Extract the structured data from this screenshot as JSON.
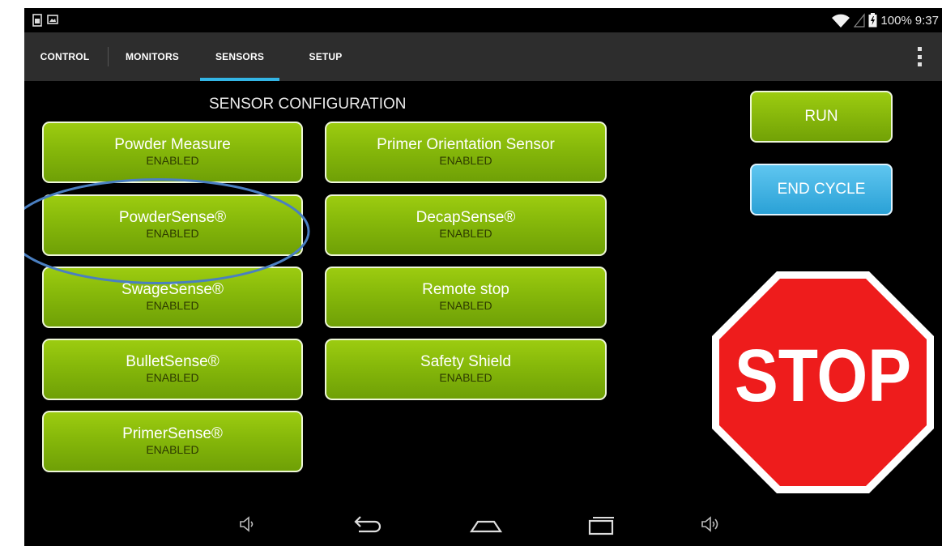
{
  "status_bar": {
    "battery": "100%",
    "time": "9:37"
  },
  "tabs": [
    {
      "label": "CONTROL",
      "selected": false
    },
    {
      "label": "MONITORS",
      "selected": false
    },
    {
      "label": "SENSORS",
      "selected": true
    },
    {
      "label": "SETUP",
      "selected": false
    }
  ],
  "section_title": "SENSOR CONFIGURATION",
  "sensors": [
    {
      "name": "Powder Measure",
      "status": "ENABLED"
    },
    {
      "name": "Primer Orientation Sensor",
      "status": "ENABLED"
    },
    {
      "name": "PowderSense®",
      "status": "ENABLED"
    },
    {
      "name": "DecapSense®",
      "status": "ENABLED"
    },
    {
      "name": "SwageSense®",
      "status": "ENABLED"
    },
    {
      "name": "Remote stop",
      "status": "ENABLED"
    },
    {
      "name": "BulletSense®",
      "status": "ENABLED"
    },
    {
      "name": "Safety Shield",
      "status": "ENABLED"
    },
    {
      "name": "PrimerSense®",
      "status": "ENABLED"
    }
  ],
  "actions": {
    "run": "RUN",
    "end_cycle": "END CYCLE",
    "stop": "STOP"
  },
  "colors": {
    "sensor_green": "#86b80a",
    "end_cycle_blue": "#2aa1d6",
    "stop_red": "#ee1c1c",
    "tab_indicator": "#33b5e5",
    "highlight_ellipse": "#4a7fc1"
  },
  "icons": [
    "sim-icon",
    "image-notification-icon",
    "wifi-icon",
    "battery-icon",
    "overflow-menu-icon",
    "volume-down-icon",
    "back-icon",
    "home-icon",
    "recent-apps-icon",
    "volume-up-icon"
  ]
}
